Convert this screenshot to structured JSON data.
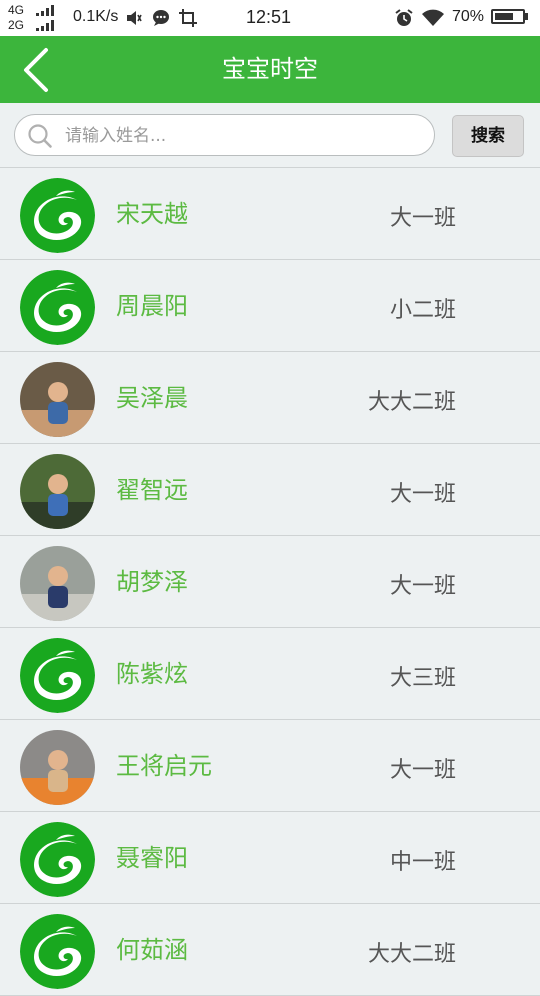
{
  "status_bar": {
    "network_top": "4G",
    "network_bottom": "2G",
    "speed": "0.1K/s",
    "time": "12:51",
    "battery": "70%",
    "battery_level": 0.7,
    "icons": [
      "signal-icon",
      "vibrate-icon",
      "chat-icon",
      "screenshot-icon",
      "alarm-icon",
      "wifi-icon",
      "battery-icon"
    ]
  },
  "header": {
    "title": "宝宝时空",
    "back_icon": "back-chevron-icon"
  },
  "search": {
    "placeholder": "请输入姓名...",
    "value": "",
    "button_label": "搜索"
  },
  "colors": {
    "brand_green": "#3cb53c",
    "name_green": "#5cba42",
    "background": "#edf1f2"
  },
  "children": [
    {
      "name": "宋天越",
      "class": "大一班",
      "avatar": "logo"
    },
    {
      "name": "周晨阳",
      "class": "小二班",
      "avatar": "logo"
    },
    {
      "name": "吴泽晨",
      "class": "大大二班",
      "avatar": "photo"
    },
    {
      "name": "翟智远",
      "class": "大一班",
      "avatar": "photo"
    },
    {
      "name": "胡梦泽",
      "class": "大一班",
      "avatar": "photo"
    },
    {
      "name": "陈紫炫",
      "class": "大三班",
      "avatar": "logo"
    },
    {
      "name": "王将启元",
      "class": "大一班",
      "avatar": "photo"
    },
    {
      "name": "聂睿阳",
      "class": "中一班",
      "avatar": "logo"
    },
    {
      "name": "何茹涵",
      "class": "大大二班",
      "avatar": "logo"
    }
  ]
}
